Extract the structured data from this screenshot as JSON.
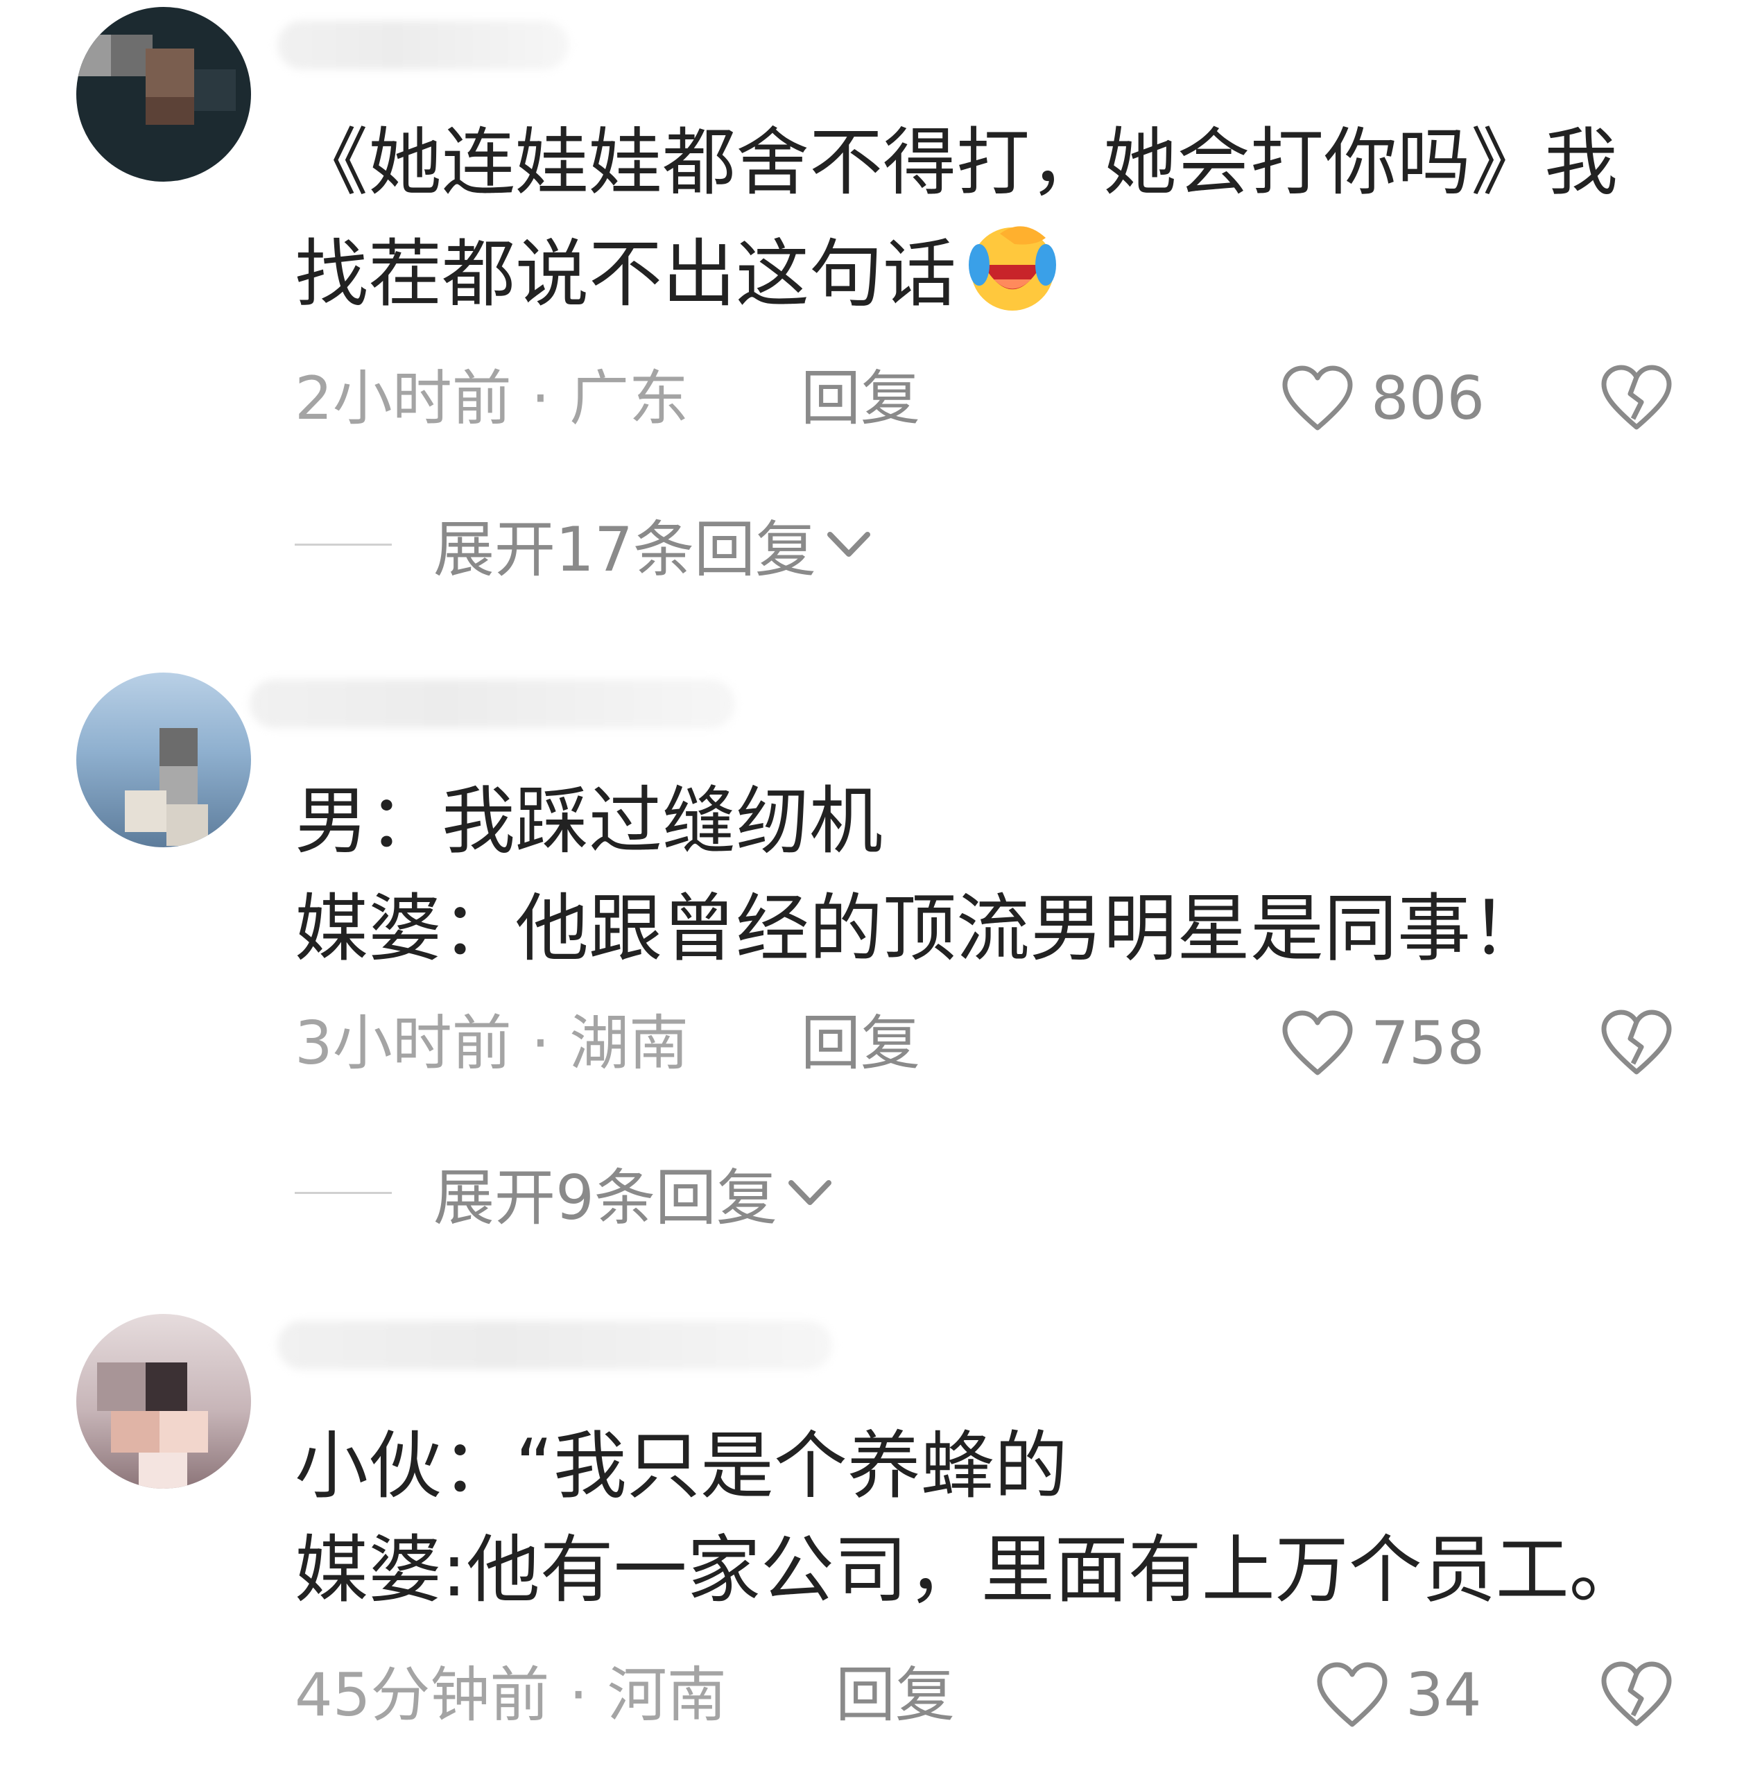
{
  "comments": [
    {
      "lines": [
        "《她连娃娃都舍不得打，她会打你吗》我",
        "找茬都说不出这句话"
      ],
      "emoji": "laughing-crying-emoji",
      "time": "2小时前",
      "separator": "·",
      "location": "广东",
      "reply_label": "回复",
      "likes": "806",
      "expand_label": "展开17条回复"
    },
    {
      "lines": [
        "男：我踩过缝纫机",
        "媒婆：他跟曾经的顶流男明星是同事！"
      ],
      "time": "3小时前",
      "separator": "·",
      "location": "湖南",
      "reply_label": "回复",
      "likes": "758",
      "expand_label": "展开9条回复"
    },
    {
      "lines": [
        "小伙：“我只是个养蜂的",
        "媒婆:他有一家公司，里面有上万个员工。"
      ],
      "time": "45分钟前",
      "separator": "·",
      "location": "河南",
      "reply_label": "回复",
      "likes": "34"
    }
  ],
  "icons": {
    "like": "heart-outline-icon",
    "dislike": "broken-heart-icon",
    "expand": "chevron-down-icon"
  },
  "colors": {
    "text": "#222222",
    "meta": "#a4a4a4",
    "icon": "#8a8a8a"
  }
}
